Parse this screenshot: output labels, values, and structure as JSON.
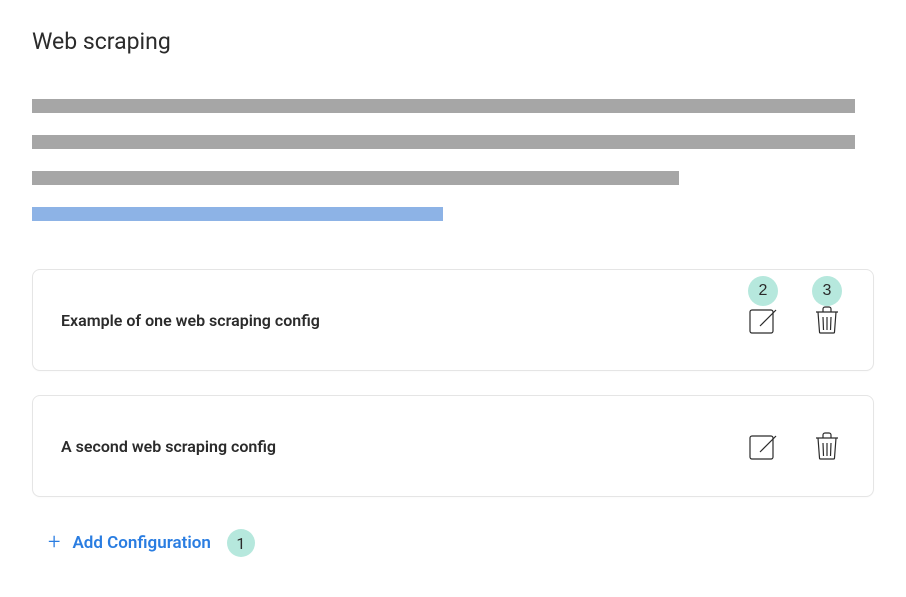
{
  "header": {
    "title": "Web scraping"
  },
  "configs": [
    {
      "title": "Example of one web scraping config",
      "edit_badge": "2",
      "delete_badge": "3"
    },
    {
      "title": "A second web scraping config",
      "edit_badge": "",
      "delete_badge": ""
    }
  ],
  "add": {
    "label": "Add Configuration",
    "badge": "1"
  }
}
